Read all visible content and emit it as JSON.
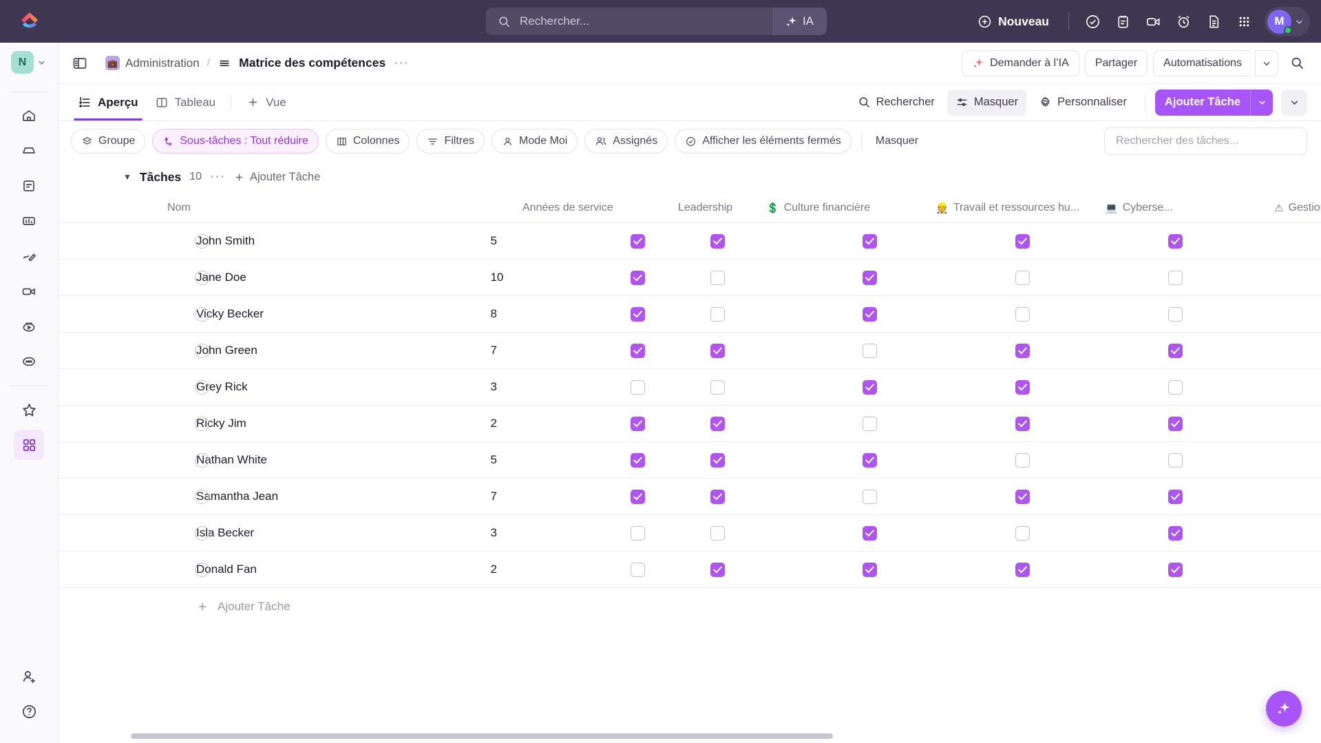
{
  "topbar": {
    "logo_icon": "clickup-logo",
    "search_placeholder": "Rechercher...",
    "ai_label": "IA",
    "new_label": "Nouveau",
    "icons": [
      "check-circle-icon",
      "clipboard-icon",
      "video-icon",
      "alarm-clock-icon",
      "document-icon",
      "apps-grid-icon"
    ],
    "avatar_initial": "M",
    "accent_purple": "#7b68ee",
    "bar_bg": "#3f3651"
  },
  "rail": {
    "workspace_initial": "N",
    "items": [
      {
        "name": "home-icon"
      },
      {
        "name": "inbox-icon"
      },
      {
        "name": "docs-icon"
      },
      {
        "name": "dashboards-icon"
      },
      {
        "name": "whiteboard-icon"
      },
      {
        "name": "clips-icon"
      },
      {
        "name": "pulse-icon"
      },
      {
        "name": "more-icon"
      }
    ],
    "favorites_icon": "star-icon",
    "apps_icon": "grid-apps-icon",
    "invite_icon": "invite-user-icon",
    "help_icon": "help-icon"
  },
  "breadcrumb": {
    "panel_toggle": "panel-toggle-icon",
    "space_label": "Administration",
    "space_emoji": "💼",
    "separator": "/",
    "list_label": "Matrice des compétences",
    "more": "···",
    "ask_ai_label": "Demander à l’IA",
    "share_label": "Partager",
    "automations_label": "Automatisations",
    "search_icon": "search-icon"
  },
  "tabs": {
    "items": [
      {
        "label": "Aperçu",
        "icon": "overview-list-icon",
        "active": true
      },
      {
        "label": "Tableau",
        "icon": "board-icon",
        "active": false
      }
    ],
    "add_view_label": "Vue",
    "search_label": "Rechercher",
    "hide_label": "Masquer",
    "customize_label": "Personnaliser",
    "add_task_label": "Ajouter Tâche",
    "accent": "#a855f7"
  },
  "toolbar": {
    "group_label": "Groupe",
    "subtasks_label": "Sous-tâches : Tout réduire",
    "columns_label": "Colonnes",
    "filters_label": "Filtres",
    "me_mode_label": "Mode Moi",
    "assignees_label": "Assignés",
    "show_closed_label": "Afficher les éléments fermés",
    "hide_label": "Masquer",
    "search_placeholder": "Rechercher des tâches...",
    "active_pill_color": "#9333ea"
  },
  "group": {
    "name": "Tâches",
    "count": "10",
    "more": "···",
    "add_task_label": "Ajouter Tâche"
  },
  "table": {
    "columns": [
      {
        "label": "Nom",
        "emoji": ""
      },
      {
        "label": "Années de service",
        "emoji": ""
      },
      {
        "label": "Leadership",
        "emoji": ""
      },
      {
        "label": "Culture financière",
        "emoji": "💲"
      },
      {
        "label": "Travail et ressources hu...",
        "emoji": "👷"
      },
      {
        "label": "Cyberse...",
        "emoji": "💻"
      },
      {
        "label": "Gestion des r",
        "emoji": "⚠"
      }
    ],
    "rows": [
      {
        "name": "John Smith",
        "years": "5",
        "skills": [
          true,
          true,
          true,
          true,
          true
        ]
      },
      {
        "name": "Jane Doe",
        "years": "10",
        "skills": [
          true,
          false,
          true,
          false,
          false
        ]
      },
      {
        "name": "Vicky Becker",
        "years": "8",
        "skills": [
          true,
          false,
          true,
          false,
          false
        ]
      },
      {
        "name": "John Green",
        "years": "7",
        "skills": [
          true,
          true,
          false,
          true,
          true
        ]
      },
      {
        "name": "Grey Rick",
        "years": "3",
        "skills": [
          false,
          false,
          true,
          true,
          false
        ]
      },
      {
        "name": "Ricky Jim",
        "years": "2",
        "skills": [
          true,
          true,
          false,
          true,
          true
        ]
      },
      {
        "name": "Nathan White",
        "years": "5",
        "skills": [
          true,
          true,
          true,
          false,
          false
        ]
      },
      {
        "name": "Samantha Jean",
        "years": "7",
        "skills": [
          true,
          true,
          false,
          true,
          true
        ]
      },
      {
        "name": "Isla Becker",
        "years": "3",
        "skills": [
          false,
          false,
          true,
          false,
          true
        ]
      },
      {
        "name": "Donald Fan",
        "years": "2",
        "skills": [
          false,
          true,
          true,
          true,
          true
        ]
      }
    ],
    "footer_add_label": "Ajouter Tâche",
    "checked_color": "#b054f0"
  }
}
